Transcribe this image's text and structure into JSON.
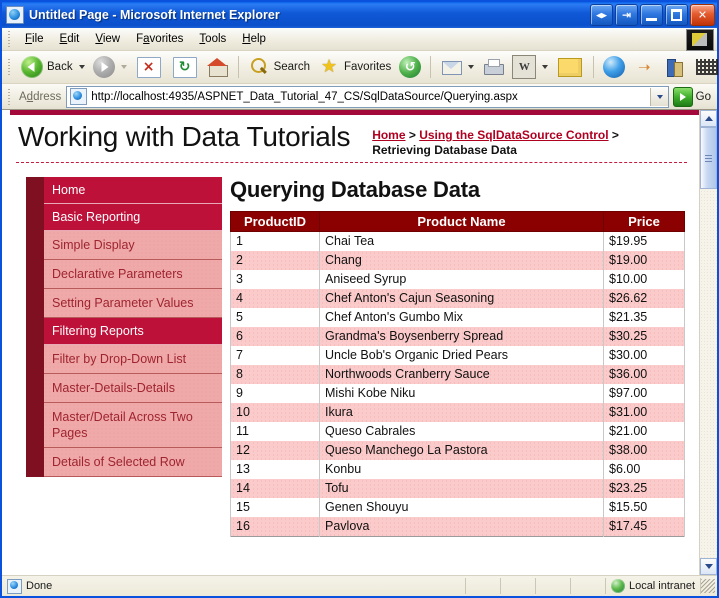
{
  "window": {
    "title": "Untitled Page - Microsoft Internet Explorer",
    "title_icon": "ie-document-icon",
    "buttons": [
      {
        "name": "restore-group-button",
        "glyph": "◀▶"
      },
      {
        "name": "separate-window-button",
        "glyph": "⬚"
      },
      {
        "name": "minimize-button",
        "glyph": "_"
      },
      {
        "name": "maximize-button",
        "glyph": "□"
      },
      {
        "name": "close-button",
        "glyph": "✕"
      }
    ]
  },
  "menubar": {
    "items": [
      {
        "name": "menu-file",
        "label": "File",
        "accel": "F"
      },
      {
        "name": "menu-edit",
        "label": "Edit",
        "accel": "E"
      },
      {
        "name": "menu-view",
        "label": "View",
        "accel": "V"
      },
      {
        "name": "menu-favorites",
        "label": "Favorites",
        "accel": "a"
      },
      {
        "name": "menu-tools",
        "label": "Tools",
        "accel": "T"
      },
      {
        "name": "menu-help",
        "label": "Help",
        "accel": "H"
      }
    ],
    "brand_icon": "ie-brand-logo"
  },
  "toolbar": {
    "back_label": "Back",
    "search_label": "Search",
    "favorites_label": "Favorites",
    "icons": [
      "back-icon",
      "forward-icon",
      "stop-icon",
      "refresh-icon",
      "home-icon",
      "search-icon",
      "favorites-star-icon",
      "history-icon",
      "mail-icon",
      "print-icon",
      "edit-icon",
      "notes-icon",
      "msn-icon",
      "messenger-icon",
      "research-icon",
      "encarta-icon"
    ]
  },
  "address": {
    "label": "Address",
    "url": "http://localhost:4935/ASPNET_Data_Tutorial_47_CS/SqlDataSource/Querying.aspx",
    "placeholder": "",
    "go_label": "Go",
    "page_icon": "page-icon",
    "dropdown_icon": "chevron-down-icon"
  },
  "page": {
    "site_title": "Working with Data Tutorials",
    "breadcrumb": {
      "home": "Home",
      "sep1": " > ",
      "section": "Using the SqlDataSource Control",
      "sep2": " > ",
      "current": "Retrieving Database Data"
    },
    "heading": "Querying Database Data",
    "sidebar": [
      {
        "name": "sidebar-item-home",
        "label": "Home",
        "type": "main"
      },
      {
        "name": "sidebar-item-basic-reporting",
        "label": "Basic Reporting",
        "type": "main"
      },
      {
        "name": "sidebar-item-simple-display",
        "label": "Simple Display",
        "type": "sub"
      },
      {
        "name": "sidebar-item-declarative-parameters",
        "label": "Declarative Parameters",
        "type": "sub"
      },
      {
        "name": "sidebar-item-setting-parameter-values",
        "label": "Setting Parameter Values",
        "type": "sub"
      },
      {
        "name": "sidebar-item-filtering-reports",
        "label": "Filtering Reports",
        "type": "main"
      },
      {
        "name": "sidebar-item-filter-by-drop-down-list",
        "label": "Filter by Drop-Down List",
        "type": "sub"
      },
      {
        "name": "sidebar-item-master-details-details",
        "label": "Master-Details-Details",
        "type": "sub"
      },
      {
        "name": "sidebar-item-master-detail-across-two-pages",
        "label": "Master/Detail Across Two Pages",
        "type": "sub"
      },
      {
        "name": "sidebar-item-details-of-selected-row",
        "label": "Details of Selected Row",
        "type": "sub"
      }
    ],
    "table": {
      "columns": [
        "ProductID",
        "Product Name",
        "Price"
      ],
      "rows": [
        [
          "1",
          "Chai Tea",
          "$19.95"
        ],
        [
          "2",
          "Chang",
          "$19.00"
        ],
        [
          "3",
          "Aniseed Syrup",
          "$10.00"
        ],
        [
          "4",
          "Chef Anton's Cajun Seasoning",
          "$26.62"
        ],
        [
          "5",
          "Chef Anton's Gumbo Mix",
          "$21.35"
        ],
        [
          "6",
          "Grandma's Boysenberry Spread",
          "$30.25"
        ],
        [
          "7",
          "Uncle Bob's Organic Dried Pears",
          "$30.00"
        ],
        [
          "8",
          "Northwoods Cranberry Sauce",
          "$36.00"
        ],
        [
          "9",
          "Mishi Kobe Niku",
          "$97.00"
        ],
        [
          "10",
          "Ikura",
          "$31.00"
        ],
        [
          "11",
          "Queso Cabrales",
          "$21.00"
        ],
        [
          "12",
          "Queso Manchego La Pastora",
          "$38.00"
        ],
        [
          "13",
          "Konbu",
          "$6.00"
        ],
        [
          "14",
          "Tofu",
          "$23.25"
        ],
        [
          "15",
          "Genen Shouyu",
          "$15.50"
        ],
        [
          "16",
          "Pavlova",
          "$17.45"
        ]
      ]
    }
  },
  "statusbar": {
    "status": "Done",
    "zone": "Local intranet",
    "status_icon": "page-icon",
    "zone_icon": "intranet-globe-icon"
  },
  "colors": {
    "titlebar_blue": "#0A52DE",
    "brand_crimson": "#BD1139",
    "brand_dark": "#7E1022",
    "table_header": "#8B0000",
    "row_alt": "#FBCBCB",
    "link_red": "#B00020",
    "sub_nav": "#EFA9A9"
  }
}
